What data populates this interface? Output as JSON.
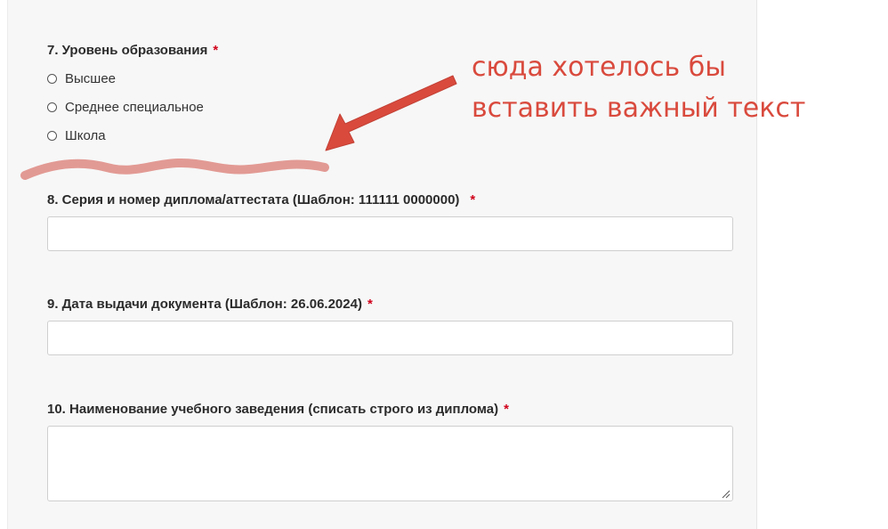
{
  "form": {
    "q7": {
      "label": "7. Уровень образования",
      "required_mark": "*",
      "options": [
        "Высшее",
        "Среднее специальное",
        "Школа"
      ]
    },
    "q8": {
      "label": "8. Серия и номер диплома/аттестата (Шаблон: 111111 0000000)",
      "required_mark": "*",
      "value": ""
    },
    "q9": {
      "label": "9. Дата выдачи документа (Шаблон: 26.06.2024)",
      "required_mark": "*",
      "value": ""
    },
    "q10": {
      "label": "10. Наименование учебного заведения (списать строго из диплома)",
      "required_mark": "*",
      "value": ""
    }
  },
  "annotation": {
    "line1": "сюда хотелось бы",
    "line2": "вставить важный текст",
    "color": "#d94a3d",
    "squiggle_color": "#e29a94"
  }
}
